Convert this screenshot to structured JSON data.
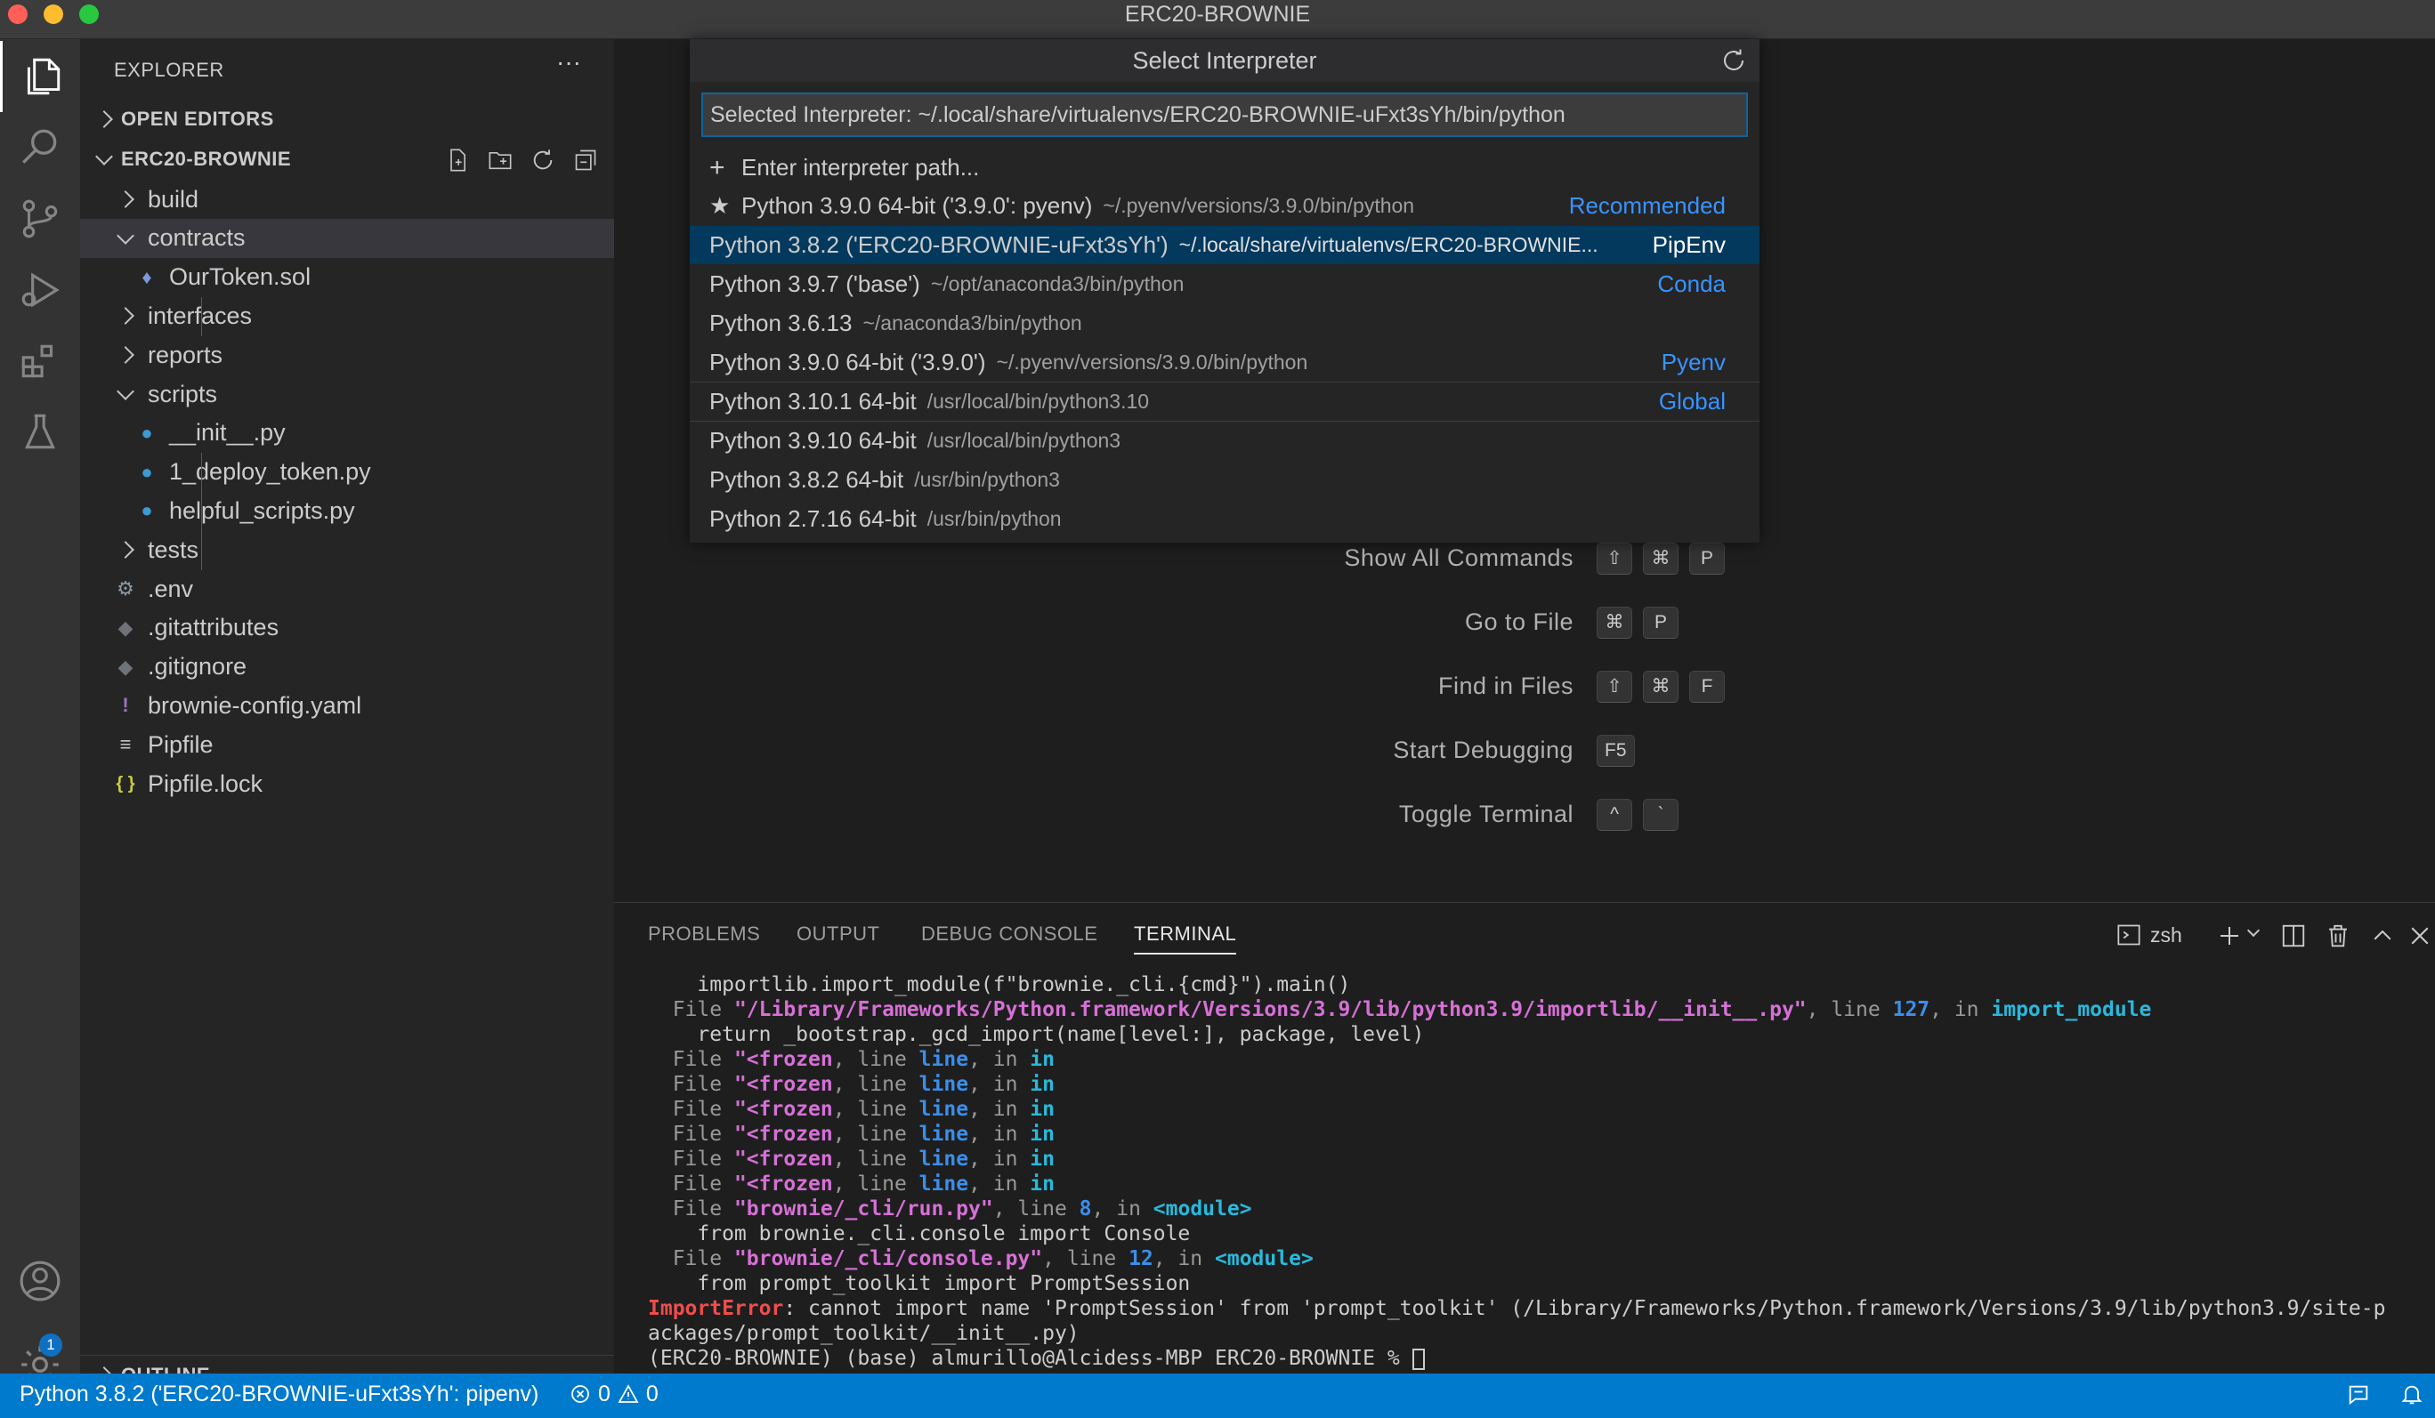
{
  "window": {
    "title": "ERC20-BROWNIE"
  },
  "activity_bar": {
    "items": [
      "explorer-icon",
      "search-icon",
      "source-control-icon",
      "run-debug-icon",
      "extensions-icon",
      "testing-icon"
    ],
    "bottom": [
      "accounts-icon",
      "manage-gear-icon"
    ],
    "badge": "1"
  },
  "sidebar": {
    "title": "EXPLORER",
    "more": "···",
    "open_editors": "OPEN EDITORS",
    "project": "ERC20-BROWNIE",
    "tree": [
      {
        "label": "build",
        "icon": ">"
      },
      {
        "label": "contracts",
        "icon": "v"
      },
      {
        "label": "OurToken.sol",
        "icon": "eth"
      },
      {
        "label": "interfaces",
        "icon": ">"
      },
      {
        "label": "reports",
        "icon": ">"
      },
      {
        "label": "scripts",
        "icon": "v"
      },
      {
        "label": "__init__.py",
        "icon": "py"
      },
      {
        "label": "1_deploy_token.py",
        "icon": "py"
      },
      {
        "label": "helpful_scripts.py",
        "icon": "py"
      },
      {
        "label": "tests",
        "icon": ">"
      },
      {
        "label": ".env",
        "icon": "gear"
      },
      {
        "label": ".gitattributes",
        "icon": "git"
      },
      {
        "label": ".gitignore",
        "icon": "git"
      },
      {
        "label": "brownie-config.yaml",
        "icon": "!"
      },
      {
        "label": "Pipfile",
        "icon": "≡"
      },
      {
        "label": "Pipfile.lock",
        "icon": "{}"
      }
    ],
    "outline": "OUTLINE"
  },
  "quick_pick": {
    "title": "Select Interpreter",
    "input_value": "Selected Interpreter: ~/.local/share/virtualenvs/ERC20-BROWNIE-uFxt3sYh/bin/python",
    "enter_path": "Enter interpreter path...",
    "items": [
      {
        "label": "Python 3.9.0 64-bit ('3.9.0': pyenv)",
        "desc": "~/.pyenv/versions/3.9.0/bin/python",
        "tag": "Recommended",
        "star": true
      },
      {
        "label": "Python 3.8.2 ('ERC20-BROWNIE-uFxt3sYh')",
        "desc": "~/.local/share/virtualenvs/ERC20-BROWNIE...",
        "tag": "PipEnv"
      },
      {
        "label": "Python 3.9.7 ('base')",
        "desc": "~/opt/anaconda3/bin/python",
        "tag": "Conda"
      },
      {
        "label": "Python 3.6.13",
        "desc": "~/anaconda3/bin/python",
        "tag": ""
      },
      {
        "label": "Python 3.9.0 64-bit ('3.9.0')",
        "desc": "~/.pyenv/versions/3.9.0/bin/python",
        "tag": "Pyenv"
      },
      {
        "label": "Python 3.10.1 64-bit",
        "desc": "/usr/local/bin/python3.10",
        "tag": "Global"
      },
      {
        "label": "Python 3.9.10 64-bit",
        "desc": "/usr/local/bin/python3",
        "tag": ""
      },
      {
        "label": "Python 3.8.2 64-bit",
        "desc": "/usr/bin/python3",
        "tag": ""
      },
      {
        "label": "Python 2.7.16 64-bit",
        "desc": "/usr/bin/python",
        "tag": ""
      }
    ]
  },
  "commands": [
    {
      "label": "Show All Commands",
      "keys": [
        "⇧",
        "⌘",
        "P"
      ]
    },
    {
      "label": "Go to File",
      "keys": [
        "⌘",
        "P"
      ]
    },
    {
      "label": "Find in Files",
      "keys": [
        "⇧",
        "⌘",
        "F"
      ]
    },
    {
      "label": "Start Debugging",
      "keys": [
        "F5"
      ]
    },
    {
      "label": "Toggle Terminal",
      "keys": [
        "^",
        "`"
      ]
    }
  ],
  "panel": {
    "tabs": [
      "PROBLEMS",
      "OUTPUT",
      "DEBUG CONSOLE",
      "TERMINAL"
    ],
    "shell": "zsh",
    "terminal": {
      "l1": "    importlib.import_module(f\"brownie._cli.{cmd}\").main()",
      "file_kw": "  File ",
      "l2_path": "\"/Library/Frameworks/Python.framework/Versions/3.9/lib/python3.9/importlib/__init__.py\"",
      "l2_line": ", line ",
      "l2_num": "127",
      "l2_in": ", in ",
      "l2_fn": "import_module",
      "l3": "    return _bootstrap._gcd_import(name[level:], package, level)",
      "frozen": "\"<frozen",
      "line_word": ", line ",
      "line_kw": "line",
      "in_word": ", in ",
      "in_kw": "in",
      "run_path": "\"brownie/_cli/run.py\"",
      "run_num": "8",
      "module": "<module>",
      "run_code": "    from brownie._cli.console import Console",
      "console_path": "\"brownie/_cli/console.py\"",
      "console_num": "12",
      "console_code": "    from prompt_toolkit import PromptSession",
      "error_name": "ImportError",
      "error_msg": ": cannot import name 'PromptSession' from 'prompt_toolkit' (/Library/Frameworks/Python.framework/Versions/3.9/lib/python3.9/site-p",
      "error_cont": "ackages/prompt_toolkit/__init__.py)",
      "prompt": "(ERC20-BROWNIE) (base) almurillo@Alcidess-MBP ERC20-BROWNIE % "
    }
  },
  "status_bar": {
    "interpreter": "Python 3.8.2 ('ERC20-BROWNIE-uFxt3sYh': pipenv)",
    "errors": "0",
    "warnings": "0"
  }
}
